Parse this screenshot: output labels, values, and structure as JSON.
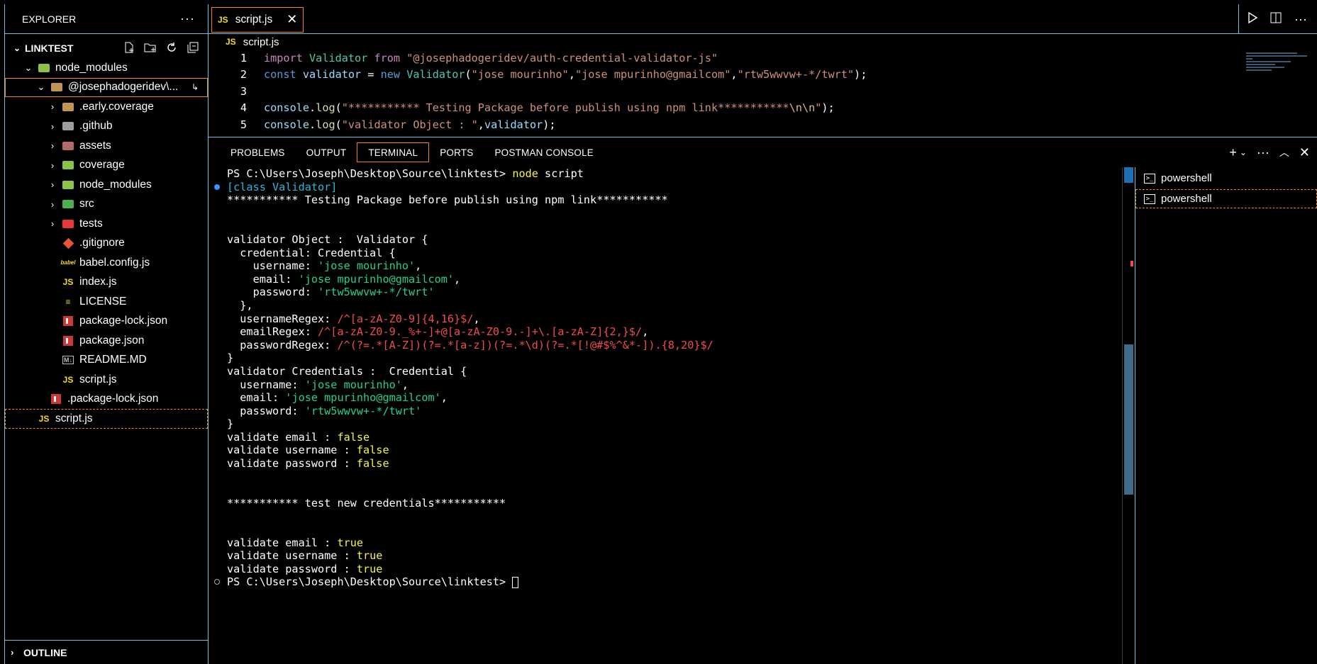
{
  "sidebar": {
    "title": "EXPLORER",
    "more": "···",
    "section": "LINKTEST",
    "outline": "OUTLINE",
    "items": [
      {
        "label": "node_modules",
        "indent": 1,
        "twisty": "⌄",
        "icon": "folder-npm"
      },
      {
        "label": "@josephadogeridev\\...",
        "indent": 2,
        "twisty": "⌄",
        "icon": "folder-open",
        "focus": true,
        "badge": "↳"
      },
      {
        "label": ".early.coverage",
        "indent": 3,
        "twisty": "›",
        "icon": "folder"
      },
      {
        "label": ".github",
        "indent": 3,
        "twisty": "›",
        "icon": "folder-github"
      },
      {
        "label": "assets",
        "indent": 3,
        "twisty": "›",
        "icon": "folder-assets"
      },
      {
        "label": "coverage",
        "indent": 3,
        "twisty": "›",
        "icon": "folder-coverage"
      },
      {
        "label": "node_modules",
        "indent": 3,
        "twisty": "›",
        "icon": "folder-npm"
      },
      {
        "label": "src",
        "indent": 3,
        "twisty": "›",
        "icon": "folder-src"
      },
      {
        "label": "tests",
        "indent": 3,
        "twisty": "›",
        "icon": "folder-tests"
      },
      {
        "label": ".gitignore",
        "indent": 3,
        "twisty": "",
        "icon": "git"
      },
      {
        "label": "babel.config.js",
        "indent": 3,
        "twisty": "",
        "icon": "babel"
      },
      {
        "label": "index.js",
        "indent": 3,
        "twisty": "",
        "icon": "js"
      },
      {
        "label": "LICENSE",
        "indent": 3,
        "twisty": "",
        "icon": "license"
      },
      {
        "label": "package-lock.json",
        "indent": 3,
        "twisty": "",
        "icon": "npm"
      },
      {
        "label": "package.json",
        "indent": 3,
        "twisty": "",
        "icon": "npm"
      },
      {
        "label": "README.MD",
        "indent": 3,
        "twisty": "",
        "icon": "md"
      },
      {
        "label": "script.js",
        "indent": 3,
        "twisty": "",
        "icon": "js"
      },
      {
        "label": ".package-lock.json",
        "indent": 2,
        "twisty": "",
        "icon": "npm"
      },
      {
        "label": "script.js",
        "indent": 1,
        "twisty": "",
        "icon": "js",
        "selected": true
      }
    ]
  },
  "editor": {
    "tab_label": "script.js",
    "tab_icon": "JS",
    "breadcrumb": "script.js",
    "line_numbers": [
      "1",
      "2",
      "3",
      "4",
      "5"
    ]
  },
  "panel": {
    "tabs": [
      "PROBLEMS",
      "OUTPUT",
      "TERMINAL",
      "PORTS",
      "POSTMAN CONSOLE"
    ],
    "active_tab": "TERMINAL",
    "terminals": [
      "powershell",
      "powershell"
    ]
  },
  "colors": {
    "border": "#6fc3df",
    "focus": "#f38518",
    "js": "#f5de19"
  }
}
